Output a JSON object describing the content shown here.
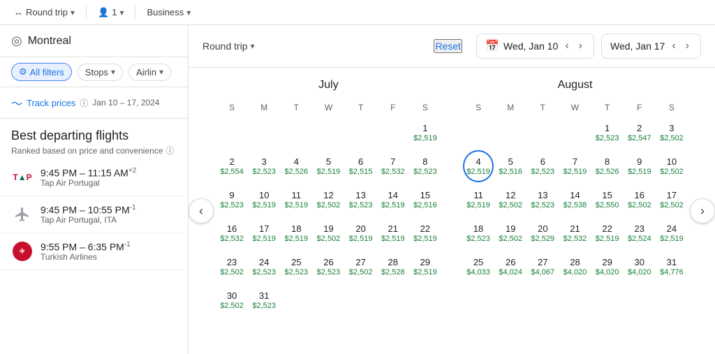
{
  "topBar": {
    "items": [
      {
        "label": "Round trip",
        "icon": "↔",
        "hasDropdown": true
      },
      {
        "label": "1",
        "icon": "👤",
        "hasDropdown": true
      },
      {
        "label": "Business",
        "hasDropdown": true
      }
    ]
  },
  "leftPanel": {
    "searchPlaceholder": "Montreal",
    "filters": [
      {
        "label": "All filters",
        "icon": "⚙",
        "active": true
      },
      {
        "label": "Stops",
        "hasDropdown": true
      },
      {
        "label": "Airlin",
        "hasDropdown": true,
        "truncated": true
      }
    ],
    "trackPrices": {
      "label": "Track prices",
      "dateRange": "Jan 10 – 17, 2024"
    },
    "bestFlights": {
      "title": "Best departing flights",
      "subtitle": "Ranked based on price and convenience"
    },
    "flights": [
      {
        "airline": "Tap Air Portugal",
        "time": "9:45 PM – 11:15 AM",
        "suffix": "+2",
        "logoType": "tap"
      },
      {
        "airline": "Tap Air Portugal, ITA",
        "time": "9:45 PM – 10:55 PM",
        "suffix": "-1",
        "logoType": "plane-gray"
      },
      {
        "airline": "Turkish Airlines",
        "time": "9:55 PM – 6:35 PM",
        "suffix": "-1",
        "logoType": "turkish"
      }
    ]
  },
  "calendarPanel": {
    "tripType": "Round trip",
    "resetLabel": "Reset",
    "date1": "Wed, Jan 10",
    "date2": "Wed, Jan 17",
    "months": [
      {
        "name": "July",
        "headers": [
          "S",
          "M",
          "T",
          "W",
          "T",
          "F",
          "S"
        ],
        "weeks": [
          [
            {
              "day": "",
              "price": ""
            },
            {
              "day": "",
              "price": ""
            },
            {
              "day": "",
              "price": ""
            },
            {
              "day": "",
              "price": ""
            },
            {
              "day": "",
              "price": ""
            },
            {
              "day": "",
              "price": ""
            },
            {
              "day": "1",
              "price": "$2,519"
            }
          ],
          [
            {
              "day": "2",
              "price": "$2,554"
            },
            {
              "day": "3",
              "price": "$2,523"
            },
            {
              "day": "4",
              "price": "$2,526"
            },
            {
              "day": "5",
              "price": "$2,519"
            },
            {
              "day": "6",
              "price": "$2,515"
            },
            {
              "day": "7",
              "price": "$2,532"
            },
            {
              "day": "8",
              "price": "$2,523"
            }
          ],
          [
            {
              "day": "9",
              "price": "$2,523"
            },
            {
              "day": "10",
              "price": "$2,519"
            },
            {
              "day": "11",
              "price": "$2,519"
            },
            {
              "day": "12",
              "price": "$2,502"
            },
            {
              "day": "13",
              "price": "$2,523"
            },
            {
              "day": "14",
              "price": "$2,519"
            },
            {
              "day": "15",
              "price": "$2,516"
            }
          ],
          [
            {
              "day": "16",
              "price": "$2,532"
            },
            {
              "day": "17",
              "price": "$2,519"
            },
            {
              "day": "18",
              "price": "$2,519"
            },
            {
              "day": "19",
              "price": "$2,502"
            },
            {
              "day": "20",
              "price": "$2,519"
            },
            {
              "day": "21",
              "price": "$2,519"
            },
            {
              "day": "22",
              "price": "$2,519"
            }
          ],
          [
            {
              "day": "23",
              "price": "$2,502"
            },
            {
              "day": "24",
              "price": "$2,523"
            },
            {
              "day": "25",
              "price": "$2,523"
            },
            {
              "day": "26",
              "price": "$2,523"
            },
            {
              "day": "27",
              "price": "$2,502"
            },
            {
              "day": "28",
              "price": "$2,528"
            },
            {
              "day": "29",
              "price": "$2,519"
            }
          ],
          [
            {
              "day": "30",
              "price": "$2,502"
            },
            {
              "day": "31",
              "price": "$2,523"
            },
            {
              "day": "",
              "price": ""
            },
            {
              "day": "",
              "price": ""
            },
            {
              "day": "",
              "price": ""
            },
            {
              "day": "",
              "price": ""
            },
            {
              "day": "",
              "price": ""
            }
          ]
        ]
      },
      {
        "name": "August",
        "headers": [
          "S",
          "M",
          "T",
          "W",
          "T",
          "F",
          "S"
        ],
        "weeks": [
          [
            {
              "day": "",
              "price": ""
            },
            {
              "day": "",
              "price": ""
            },
            {
              "day": "",
              "price": ""
            },
            {
              "day": "",
              "price": ""
            },
            {
              "day": "1",
              "price": "$2,523"
            },
            {
              "day": "2",
              "price": "$2,547"
            },
            {
              "day": "3",
              "price": "$2,502"
            }
          ],
          [
            {
              "day": "4",
              "price": "$2,519",
              "selected": true
            },
            {
              "day": "5",
              "price": "$2,516"
            },
            {
              "day": "6",
              "price": "$2,523"
            },
            {
              "day": "7",
              "price": "$2,519"
            },
            {
              "day": "8",
              "price": "$2,526"
            },
            {
              "day": "9",
              "price": "$2,519"
            },
            {
              "day": "10",
              "price": "$2,502"
            }
          ],
          [
            {
              "day": "11",
              "price": "$2,519"
            },
            {
              "day": "12",
              "price": "$2,502"
            },
            {
              "day": "13",
              "price": "$2,523"
            },
            {
              "day": "14",
              "price": "$2,538"
            },
            {
              "day": "15",
              "price": "$2,550"
            },
            {
              "day": "16",
              "price": "$2,502"
            },
            {
              "day": "17",
              "price": "$2,502"
            }
          ],
          [
            {
              "day": "18",
              "price": "$2,523"
            },
            {
              "day": "19",
              "price": "$2,502"
            },
            {
              "day": "20",
              "price": "$2,529"
            },
            {
              "day": "21",
              "price": "$2,532"
            },
            {
              "day": "22",
              "price": "$2,519"
            },
            {
              "day": "23",
              "price": "$2,524"
            },
            {
              "day": "24",
              "price": "$2,519"
            }
          ],
          [
            {
              "day": "25",
              "price": "$4,033"
            },
            {
              "day": "26",
              "price": "$4,024"
            },
            {
              "day": "27",
              "price": "$4,067"
            },
            {
              "day": "28",
              "price": "$4,020"
            },
            {
              "day": "29",
              "price": "$4,020"
            },
            {
              "day": "30",
              "price": "$4,020"
            },
            {
              "day": "31",
              "price": "$4,776"
            }
          ]
        ]
      }
    ]
  }
}
